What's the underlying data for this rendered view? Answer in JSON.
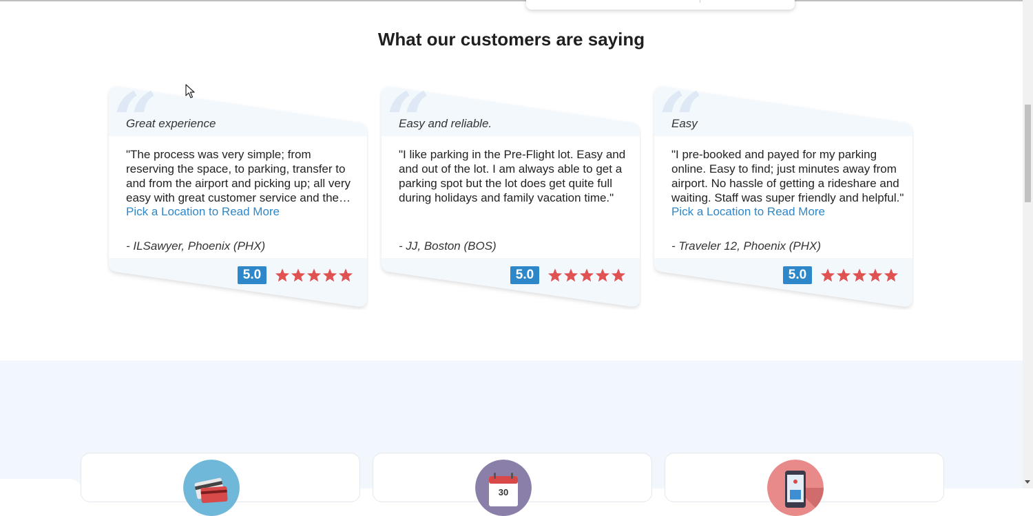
{
  "section_title": "What our customers are saying",
  "reviews": [
    {
      "title": "Great experience",
      "body": "\"The process was very simple; from reserving the space, to parking, transfer to and from the airport and picking up; all very easy with great customer service and the staff was very helpful.\"",
      "link": "Pick a Location to Read More",
      "author": "- ILSawyer, Phoenix (PHX)",
      "rating": "5.0",
      "stars": 5
    },
    {
      "title": "Easy and reliable.",
      "body": "\"I like parking in the Pre-Flight lot. Easy and and out of the lot. I am always able to get a parking spot but the lot does get quite full during holidays and family vacation time.\"",
      "link": "",
      "author": "- JJ, Boston (BOS)",
      "rating": "5.0",
      "stars": 5
    },
    {
      "title": "Easy",
      "body": "\"I pre-booked and payed for my parking online. Easy to find; just minutes away from airport. No hassle of getting a rideshare and waiting. Staff was super friendly and helpful.\"",
      "link": "Pick a Location to Read More",
      "author": "- Traveler 12, Phoenix (PHX)",
      "rating": "5.0",
      "stars": 5
    }
  ],
  "features": [
    {
      "icon": "credit-card-icon"
    },
    {
      "icon": "calendar-icon",
      "calendar_day": "30"
    },
    {
      "icon": "mobile-phone-icon"
    }
  ],
  "colors": {
    "accent_blue": "#2d87c8",
    "star_red": "#e05252",
    "features_bg": "#f2f7fe"
  }
}
